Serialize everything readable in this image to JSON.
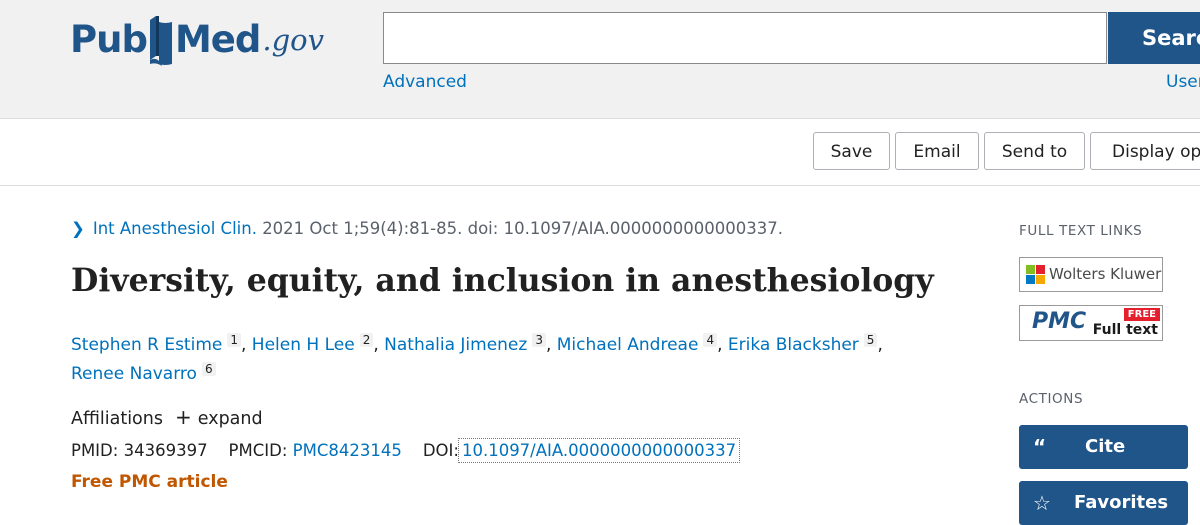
{
  "header": {
    "logo": {
      "pub": "Pub",
      "med": "Med",
      "gov": ".gov"
    },
    "search": {
      "value": "",
      "placeholder": "",
      "button_label": "Search"
    },
    "advanced_label": "Advanced",
    "user_guide_label": "User Guide"
  },
  "toolbar": {
    "save_label": "Save",
    "email_label": "Email",
    "send_to_label": "Send to",
    "display_options_label": "Display options"
  },
  "citation": {
    "journal": "Int Anesthesiol Clin.",
    "details": "2021 Oct 1;59(4):81-85. doi: 10.1097/AIA.0000000000000337."
  },
  "article": {
    "title": "Diversity, equity, and inclusion in anesthesiology",
    "authors": [
      {
        "name": "Stephen R Estime",
        "aff": "1"
      },
      {
        "name": "Helen H Lee",
        "aff": "2"
      },
      {
        "name": "Nathalia Jimenez",
        "aff": "3"
      },
      {
        "name": "Michael Andreae",
        "aff": "4"
      },
      {
        "name": "Erika Blacksher",
        "aff": "5"
      },
      {
        "name": "Renee Navarro",
        "aff": "6"
      }
    ],
    "affiliations_label": "Affiliations",
    "expand_label": "expand",
    "pmid_label": "PMID:",
    "pmid": "34369397",
    "pmcid_label": "PMCID:",
    "pmcid": "PMC8423145",
    "doi_label": "DOI:",
    "doi": "10.1097/AIA.0000000000000337",
    "free_label": "Free PMC article"
  },
  "sidebar": {
    "full_text_links_heading": "FULL TEXT LINKS",
    "wolters_kluwer_label": "Wolters Kluwer",
    "pmc_badge": {
      "pmc": "PMC",
      "free": "FREE",
      "full_text": "Full text"
    },
    "actions_heading": "ACTIONS",
    "cite_label": "Cite",
    "favorites_label": "Favorites"
  },
  "colors": {
    "brand_blue": "#20558a",
    "link_blue": "#0071bc",
    "free_orange": "#c05600",
    "header_gray": "#f1f1f1"
  }
}
